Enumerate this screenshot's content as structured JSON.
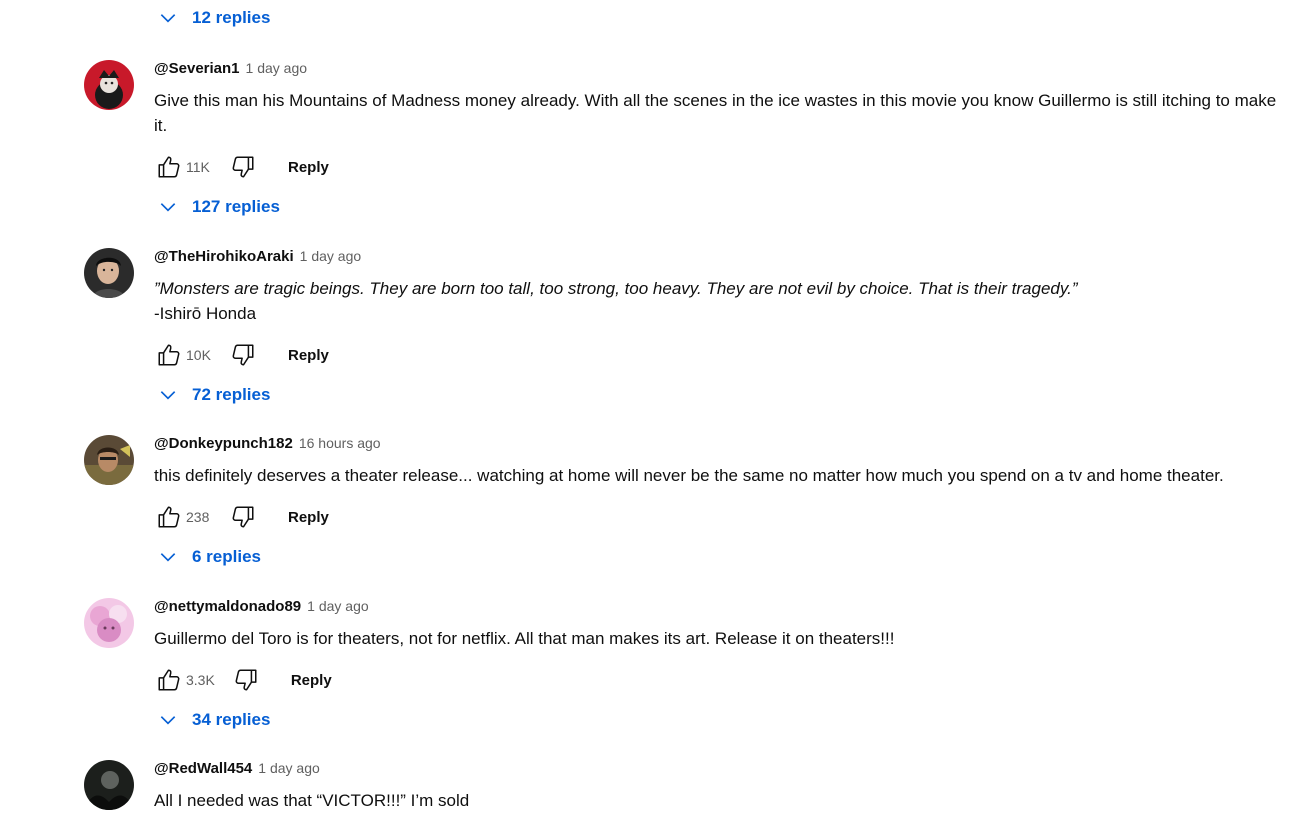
{
  "top_replies_label": "12 replies",
  "comments": [
    {
      "author": "@Severian1",
      "time": "1 day ago",
      "text": "Give this man his Mountains of Madness money already. With all the scenes in the ice wastes in this movie you know Guillermo is still itching to make it.",
      "likes": "11K",
      "reply_label": "Reply",
      "replies_label": "127 replies"
    },
    {
      "author": "@TheHirohikoAraki",
      "time": "1 day ago",
      "quote": "”Monsters are tragic beings. They are born too tall, too strong, too heavy. They are not evil by choice. That is their tragedy.”",
      "attribution": "-Ishirō Honda",
      "likes": "10K",
      "reply_label": "Reply",
      "replies_label": "72 replies"
    },
    {
      "author": "@Donkeypunch182",
      "time": "16 hours ago",
      "text": "this definitely deserves a theater release... watching at home will never be the same no matter how much you spend on a tv and home theater.",
      "likes": "238",
      "reply_label": "Reply",
      "replies_label": "6 replies"
    },
    {
      "author": "@nettymaldonado89",
      "time": "1 day ago",
      "text": "Guillermo del Toro is for theaters, not for netflix. All that man makes its art. Release it on theaters!!!",
      "likes": "3.3K",
      "reply_label": "Reply",
      "replies_label": "34 replies"
    },
    {
      "author": "@RedWall454",
      "time": "1 day ago",
      "text": "All I needed was that “VICTOR!!!” I’m sold"
    }
  ],
  "icons": {
    "like": "thumb-up-icon",
    "dislike": "thumb-down-icon",
    "expand": "chevron-down-icon"
  },
  "colors": {
    "link_blue": "#065fd4",
    "text": "#0f0f0f",
    "secondary": "#606060"
  }
}
